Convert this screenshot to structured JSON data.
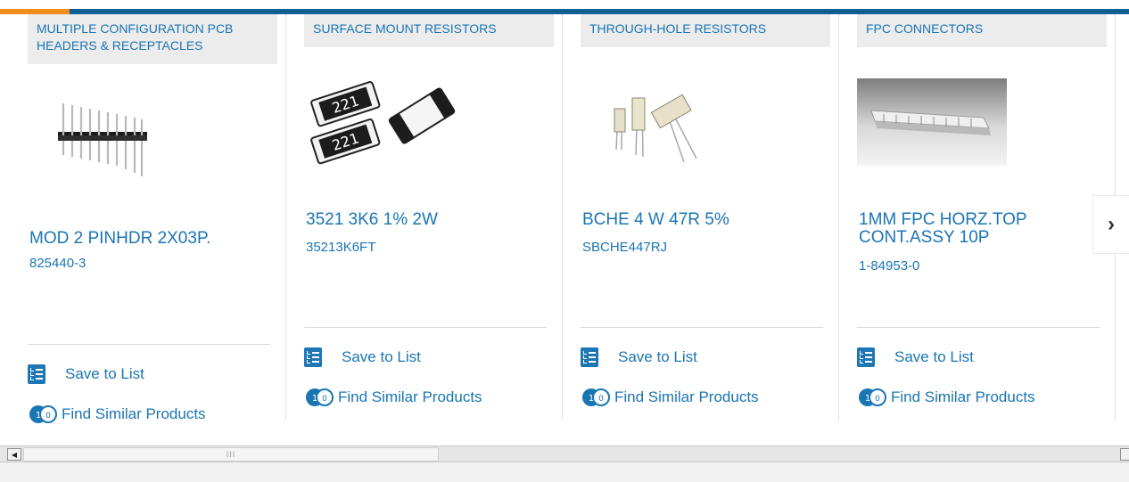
{
  "products": [
    {
      "category": "MULTIPLE CONFIGURATION PCB HEADERS & RECEPTACLES",
      "name": "MOD 2 PINHDR 2X03P.",
      "part_number": "825440-3",
      "save_label": "Save to List",
      "similar_label": "Find Similar Products"
    },
    {
      "category": "SURFACE MOUNT RESISTORS",
      "name": "3521 3K6 1% 2W",
      "part_number": "35213K6FT",
      "save_label": "Save to List",
      "similar_label": "Find Similar Products",
      "image_text": "221"
    },
    {
      "category": "THROUGH-HOLE RESISTORS",
      "name": "BCHE 4 W 47R 5%",
      "part_number": "SBCHE447RJ",
      "save_label": "Save to List",
      "similar_label": "Find Similar Products"
    },
    {
      "category": "FPC CONNECTORS",
      "name": "1MM FPC HORZ.TOP CONT.ASSY 10P",
      "part_number": "1-84953-0",
      "save_label": "Save to List",
      "similar_label": "Find Similar Products"
    }
  ],
  "carousel": {
    "next_icon": "chevron-right-icon",
    "next_glyph": "›"
  },
  "scrollbar": {
    "left_icon": "scroll-left-icon",
    "right_icon": "scroll-right-icon",
    "left_glyph": "◀",
    "grip_glyph": "III"
  },
  "colors": {
    "brand_blue": "#1a75b3",
    "header_bar": "#0f5e94",
    "accent_orange": "#f28c1c",
    "category_bg": "#ececec"
  }
}
